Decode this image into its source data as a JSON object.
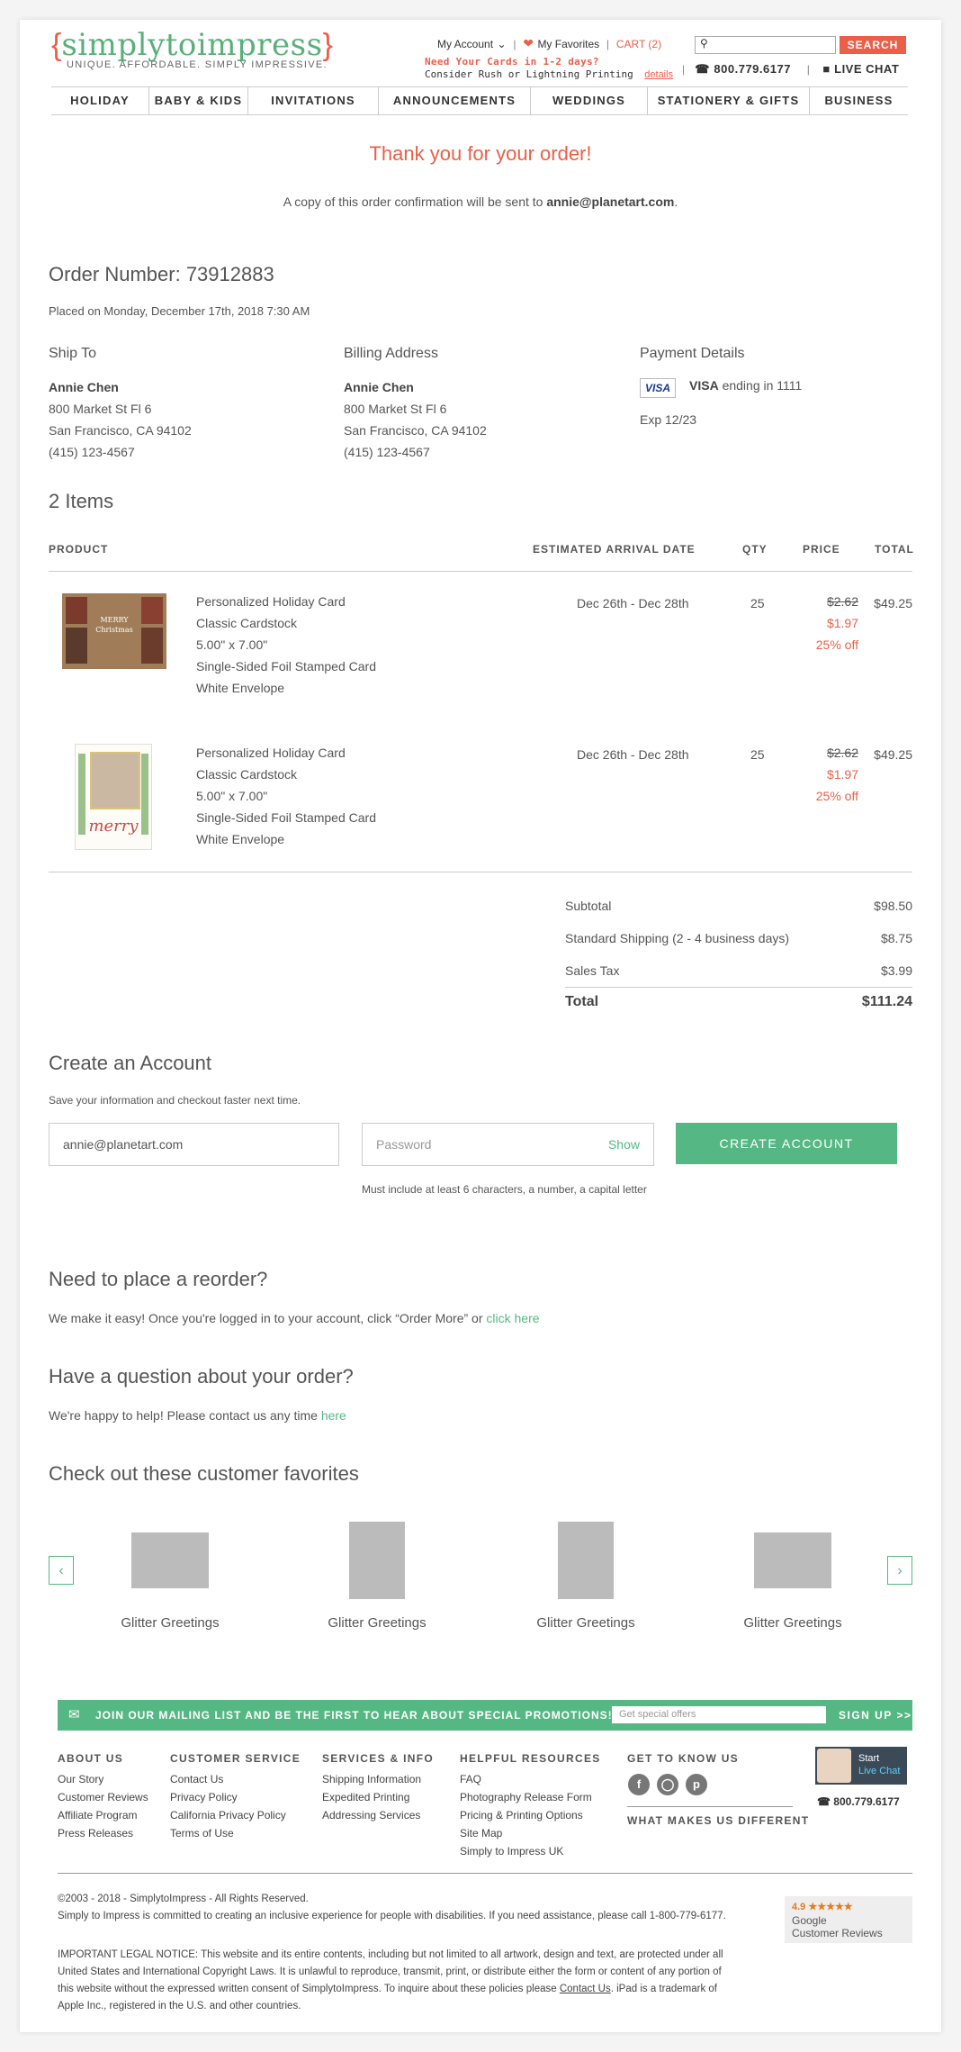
{
  "header": {
    "brace_left": "{",
    "brand": "simplytoimpress",
    "brace_right": "}",
    "tagline": "UNIQUE. AFFORDABLE. SIMPLY IMPRESSIVE.",
    "my_account": "My Account",
    "my_favorites": "My Favorites",
    "cart": "CART (2)",
    "search_button": "SEARCH",
    "rush_line1": "Need Your Cards in 1-2 days?",
    "rush_line2": "Consider Rush or Lightning Printing",
    "details_link": "details",
    "phone": "800.779.6177",
    "live_chat": "LIVE CHAT"
  },
  "nav": [
    "HOLIDAY",
    "BABY & KIDS",
    "INVITATIONS",
    "ANNOUNCEMENTS",
    "WEDDINGS",
    "STATIONERY & GIFTS",
    "BUSINESS"
  ],
  "confirmation": {
    "thanks": "Thank you for your order!",
    "copy_prefix": "A copy of this order confirmation will be sent to ",
    "email": "annie@planetart.com",
    "copy_suffix": "."
  },
  "order": {
    "number_label": "Order Number: 73912883",
    "placed": "Placed on Monday, December 17th, 2018 7:30 AM",
    "ship_to": {
      "title": "Ship To",
      "name": "Annie Chen",
      "street": "800 Market St Fl 6",
      "city": "San Francisco, CA 94102",
      "phone": "(415) 123-4567"
    },
    "billing": {
      "title": "Billing Address",
      "name": "Annie Chen",
      "street": "800 Market St Fl 6",
      "city": "San Francisco, CA 94102",
      "phone": "(415) 123-4567"
    },
    "payment": {
      "title": "Payment Details",
      "card_brand": "VISA",
      "card_text": "ending in 1111",
      "exp": "Exp 12/23"
    }
  },
  "items_heading": "2 Items",
  "table_headers": {
    "product": "PRODUCT",
    "arrival": "ESTIMATED ARRIVAL DATE",
    "qty": "QTY",
    "price": "PRICE",
    "total": "TOTAL"
  },
  "items": [
    {
      "name": "Personalized Holiday Card",
      "paper": "Classic Cardstock",
      "size": "5.00\" x 7.00\"",
      "style": "Single-Sided Foil Stamped Card",
      "envelope": "White Envelope",
      "arrival": "Dec 26th - Dec 28th",
      "qty": "25",
      "orig_price": "$2.62",
      "price": "$1.97",
      "discount": "25% off",
      "total": "$49.25",
      "card_text": "MERRY Christmas"
    },
    {
      "name": "Personalized Holiday Card",
      "paper": "Classic Cardstock",
      "size": "5.00\" x 7.00\"",
      "style": "Single-Sided Foil Stamped Card",
      "envelope": "White Envelope",
      "arrival": "Dec 26th - Dec 28th",
      "qty": "25",
      "orig_price": "$2.62",
      "price": "$1.97",
      "discount": "25% off",
      "total": "$49.25",
      "card_text": "merry"
    }
  ],
  "summary": {
    "subtotal_label": "Subtotal",
    "subtotal": "$98.50",
    "shipping_label": "Standard Shipping (2 - 4 business days)",
    "shipping": "$8.75",
    "tax_label": "Sales Tax",
    "tax": "$3.99",
    "total_label": "Total",
    "total": "$111.24"
  },
  "account": {
    "heading": "Create an Account",
    "subtext": "Save your information and checkout faster next time.",
    "email_value": "annie@planetart.com",
    "password_placeholder": "Password",
    "show": "Show",
    "button": "CREATE ACCOUNT",
    "hint": "Must include at least 6 characters, a number, a capital letter"
  },
  "reorder": {
    "heading": "Need to place a reorder?",
    "text": "We make it easy! Once you're logged in to your account, click “Order More” or ",
    "link": "click here"
  },
  "question": {
    "heading": "Have a question about your order?",
    "text": "We're happy to help! Please contact us any time ",
    "link": "here"
  },
  "favorites": {
    "heading": "Check out these customer favorites",
    "items": [
      "Glitter Greetings",
      "Glitter Greetings",
      "Glitter Greetings",
      "Glitter Greetings"
    ]
  },
  "footer": {
    "mailing_text": "JOIN OUR MAILING LIST AND BE THE FIRST TO HEAR ABOUT SPECIAL PROMOTIONS!",
    "mailing_placeholder": "Get special offers",
    "signup": "SIGN UP >>",
    "about": {
      "title": "ABOUT US",
      "links": [
        "Our Story",
        "Customer Reviews",
        "Affiliate Program",
        "Press Releases"
      ]
    },
    "service": {
      "title": "CUSTOMER SERVICE",
      "links": [
        "Contact Us",
        "Privacy Policy",
        "California Privacy Policy",
        "Terms of Use"
      ]
    },
    "services": {
      "title": "SERVICES & INFO",
      "links": [
        "Shipping Information",
        "Expedited Printing",
        "Addressing Services"
      ]
    },
    "resources": {
      "title": "HELPFUL RESOURCES",
      "links": [
        "FAQ",
        "Photography Release Form",
        "Pricing & Printing Options",
        "Site Map",
        "Simply to Impress UK"
      ]
    },
    "know": {
      "title": "GET TO KNOW US",
      "different": "WHAT MAKES US DIFFERENT"
    },
    "chat_start": "Start",
    "chat_live": "Live Chat",
    "phone": "800.779.6177",
    "copyright": "©2003 - 2018 - SimplytoImpress - All Rights Reserved.",
    "inclusive": "Simply to Impress is committed to creating an inclusive experience for people with disabilities. If you need assistance, please call 1-800-779-6177.",
    "legal_1": "IMPORTANT LEGAL NOTICE: This website and its entire contents, including but not limited to all artwork, design and text, are protected under all",
    "legal_2": "United States and International Copyright Laws. It is unlawful to reproduce, transmit, print, or distribute either the form or content of any portion of",
    "legal_3": "this website without the expressed written consent of SimplytoImpress. To inquire about these policies please ",
    "legal_link": "Contact Us",
    "legal_3b": ". iPad is a trademark of",
    "legal_4": "Apple Inc., registered in the U.S. and other countries.",
    "rating": "4.9",
    "stars": "★★★★★",
    "google": "Google",
    "reviews": "Customer Reviews"
  },
  "colors": {
    "accent": "#ea5f48",
    "brand_green": "#55b884"
  }
}
